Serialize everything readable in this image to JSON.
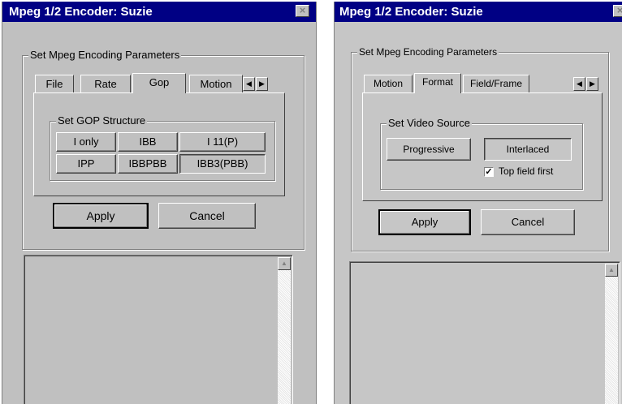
{
  "left_window": {
    "title": "Mpeg 1/2 Encoder: Suzie",
    "close_glyph": "×",
    "group_label": "Set Mpeg Encoding Parameters",
    "tabs": [
      "File",
      "Rate",
      "Gop",
      "Motion"
    ],
    "selected_tab": "Gop",
    "scroll_left": "◀",
    "scroll_right": "▶",
    "inner_group_label": "Set GOP Structure",
    "gop_buttons": [
      "I only",
      "IBB",
      "I 11(P)",
      "IPP",
      "IBBPBB",
      "IBB3(PBB)"
    ],
    "selected_gop": "IBB3(PBB)",
    "apply_label": "Apply",
    "cancel_label": "Cancel",
    "scroll_up_glyph": "▲"
  },
  "right_window": {
    "title": "Mpeg 1/2 Encoder: Suzie",
    "close_glyph": "×",
    "group_label": "Set Mpeg Encoding Parameters",
    "tabs": [
      "Motion",
      "Format",
      "Field/Frame"
    ],
    "selected_tab": "Format",
    "scroll_left": "◀",
    "scroll_right": "▶",
    "inner_group_label": "Set Video Source",
    "source_buttons": [
      "Progressive",
      "Interlaced"
    ],
    "selected_source": "Interlaced",
    "top_field_first_label": "Top field first",
    "top_field_first_checked": true,
    "check_glyph": "✓",
    "apply_label": "Apply",
    "cancel_label": "Cancel",
    "scroll_up_glyph": "▲"
  }
}
